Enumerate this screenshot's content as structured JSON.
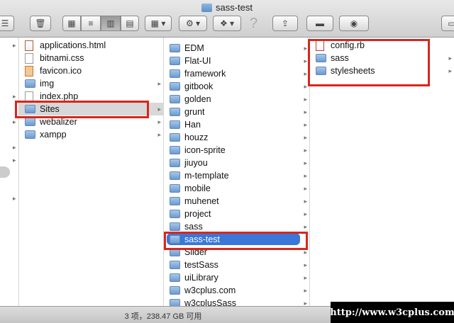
{
  "window": {
    "title": "sass-test"
  },
  "toolbar": {
    "help_glyph": "?"
  },
  "column1": {
    "items": [
      {
        "name": "applications.html",
        "kind": "html"
      },
      {
        "name": "bitnami.css",
        "kind": "doc"
      },
      {
        "name": "favicon.ico",
        "kind": "ico"
      },
      {
        "name": "img",
        "kind": "folder"
      },
      {
        "name": "index.php",
        "kind": "doc"
      },
      {
        "name": "Sites",
        "kind": "folder"
      },
      {
        "name": "webalizer",
        "kind": "folder"
      },
      {
        "name": "xampp",
        "kind": "folder"
      }
    ]
  },
  "column2": {
    "items": [
      "EDM",
      "Flat-UI",
      "framework",
      "gitbook",
      "golden",
      "grunt",
      "Han",
      "houzz",
      "icon-sprite",
      "jiuyou",
      "m-template",
      "mobile",
      "muhenet",
      "project",
      "sass",
      "sass-test",
      "Slider",
      "testSass",
      "uiLibrary",
      "w3cplus.com",
      "w3cplusSass"
    ]
  },
  "column3": {
    "items": [
      {
        "name": "config.rb",
        "kind": "rb"
      },
      {
        "name": "sass",
        "kind": "folder"
      },
      {
        "name": "stylesheets",
        "kind": "folder"
      }
    ]
  },
  "status": {
    "text": "3 项，238.47 GB 可用"
  },
  "watermark": {
    "text": "http://www.w3cplus.com"
  },
  "colors": {
    "highlight": "#d9261c",
    "selection": "#3a77d8"
  }
}
